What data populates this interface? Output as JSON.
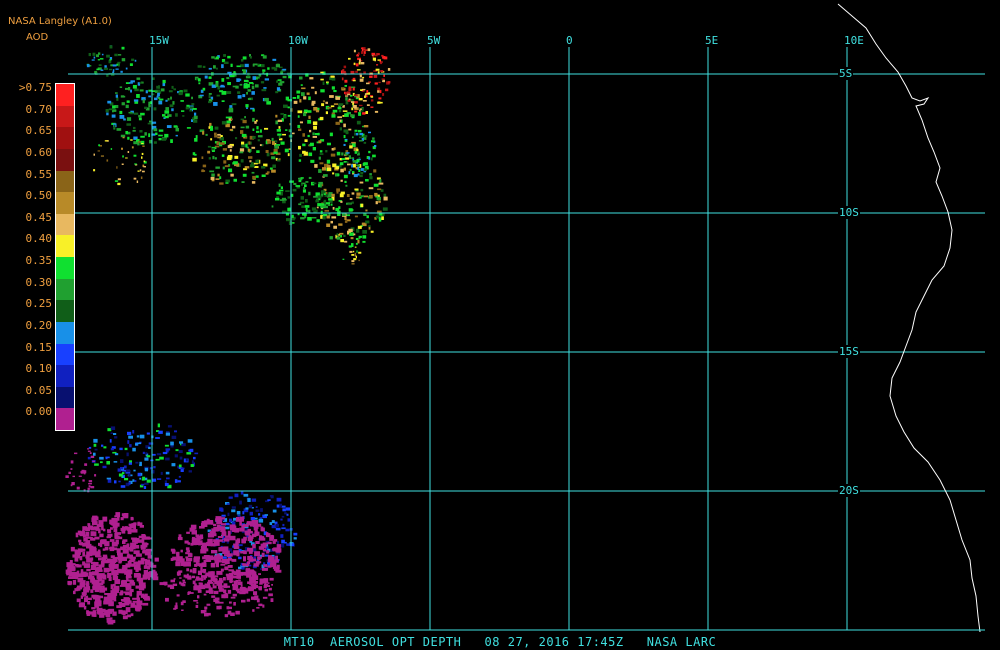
{
  "header": {
    "source": "NASA Langley (A1.0)",
    "variable": "AOD"
  },
  "colorbar": {
    "labels": [
      ">0.75",
      "0.70",
      "0.65",
      "0.60",
      "0.55",
      "0.50",
      "0.45",
      "0.40",
      "0.35",
      "0.30",
      "0.25",
      "0.20",
      "0.15",
      "0.10",
      "0.05",
      "0.00"
    ],
    "colors": [
      "#ff2020",
      "#c81818",
      "#a01010",
      "#7a1010",
      "#8a6418",
      "#b88a28",
      "#e8b860",
      "#f8f028",
      "#10e030",
      "#20a030",
      "#105e18",
      "#1890e8",
      "#1840ff",
      "#1020c0",
      "#081070",
      "#b02090"
    ]
  },
  "longitude_labels": [
    "15W",
    "10W",
    "5W",
    "0",
    "5E",
    "10E"
  ],
  "latitude_labels": [
    "5S",
    "10S",
    "15S",
    "20S"
  ],
  "footer": {
    "text": "MT10  AEROSOL OPT DEPTH   08 27, 2016 17:45Z   NASA LARC"
  },
  "colors": {
    "grid": "#40e0e0",
    "coast": "#ffffff",
    "background": "#000000",
    "label": "#f0a040"
  }
}
